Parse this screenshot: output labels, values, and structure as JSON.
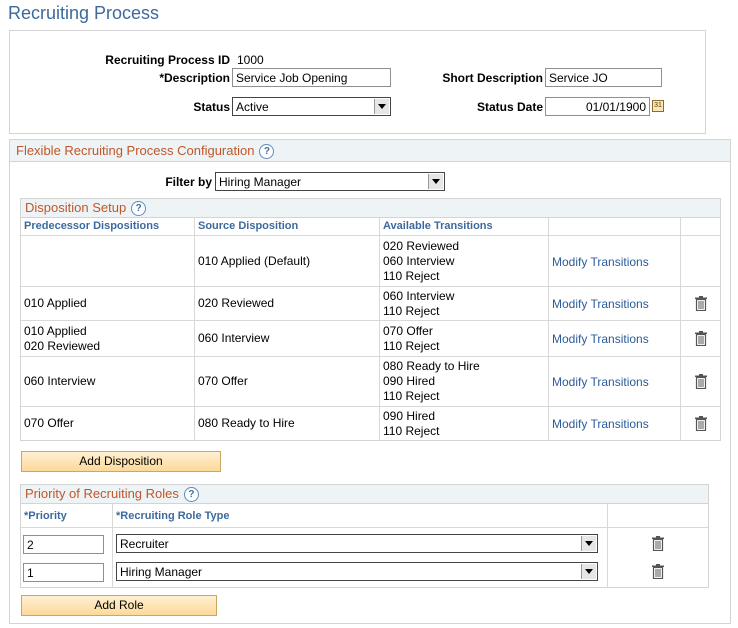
{
  "page_title": "Recruiting Process",
  "header": {
    "process_id_label": "Recruiting Process ID",
    "process_id_value": "1000",
    "description_label": "*Description",
    "description_value": "Service Job Opening",
    "short_description_label": "Short Description",
    "short_description_value": "Service JO",
    "status_label": "Status",
    "status_value": "Active",
    "status_date_label": "Status Date",
    "status_date_value": "01/01/1900"
  },
  "config": {
    "title": "Flexible Recruiting Process Configuration",
    "help": "?",
    "filter_label": "Filter by",
    "filter_value": "Hiring Manager"
  },
  "disposition": {
    "title": "Disposition Setup",
    "help": "?",
    "columns": [
      "Predecessor Dispositions",
      "Source Disposition",
      "Available Transitions"
    ],
    "rows": [
      {
        "predecessor": [],
        "source": "010 Applied (Default)",
        "transitions": [
          "020 Reviewed",
          "060 Interview",
          "110 Reject"
        ],
        "link": "Modify Transitions"
      },
      {
        "predecessor": [
          "010 Applied"
        ],
        "source": "020 Reviewed",
        "transitions": [
          "060 Interview",
          "110 Reject"
        ],
        "link": "Modify Transitions"
      },
      {
        "predecessor": [
          "010 Applied",
          "020 Reviewed"
        ],
        "source": "060 Interview",
        "transitions": [
          "070 Offer",
          "110 Reject"
        ],
        "link": "Modify Transitions"
      },
      {
        "predecessor": [
          "060 Interview"
        ],
        "source": "070 Offer",
        "transitions": [
          "080 Ready to Hire",
          "090 Hired",
          "110 Reject"
        ],
        "link": "Modify Transitions"
      },
      {
        "predecessor": [
          "070 Offer"
        ],
        "source": "080 Ready to Hire",
        "transitions": [
          "090 Hired",
          "110 Reject"
        ],
        "link": "Modify Transitions"
      }
    ],
    "add_button": "Add Disposition"
  },
  "roles": {
    "title": "Priority of Recruiting Roles",
    "help": "?",
    "col_priority": "*Priority",
    "col_role_type": "*Recruiting Role Type",
    "rows": [
      {
        "priority": "2",
        "role": "Recruiter"
      },
      {
        "priority": "1",
        "role": "Hiring Manager"
      }
    ],
    "add_button": "Add Role"
  }
}
